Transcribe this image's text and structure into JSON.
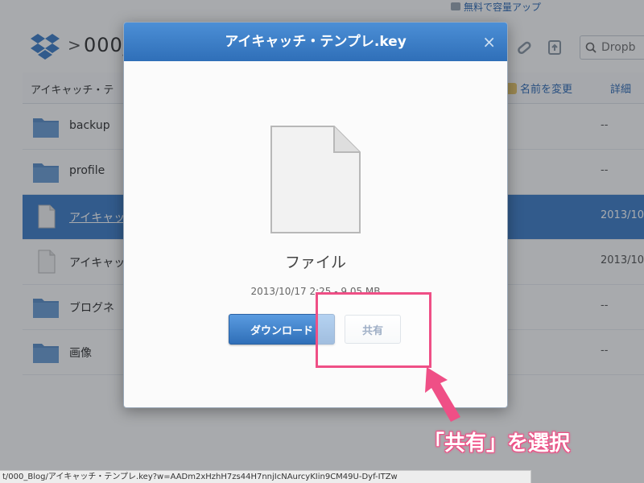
{
  "promo": {
    "text": "無料で容量アップ"
  },
  "header": {
    "breadcrumb_separator": ">",
    "folder_name": "000_",
    "search_placeholder": "Dropb"
  },
  "toolbar": {
    "selected_title": "アイキャッチ・テ",
    "rename_label": "名前を変更",
    "details_label": "詳細"
  },
  "files": [
    {
      "name": "backup",
      "type": "folder",
      "modified": "--",
      "selected": false
    },
    {
      "name": "profile",
      "type": "folder",
      "modified": "--",
      "selected": false
    },
    {
      "name": "アイキャッ",
      "type": "file",
      "modified": "2013/10",
      "selected": true
    },
    {
      "name": "アイキャッ",
      "type": "file",
      "modified": "2013/10",
      "selected": false
    },
    {
      "name": "ブログネ",
      "type": "folder",
      "modified": "--",
      "selected": false
    },
    {
      "name": "画像",
      "type": "folder",
      "modified": "--",
      "selected": false
    }
  ],
  "modal": {
    "title": "アイキャッチ・テンプレ.key",
    "close_symbol": "×",
    "file_kind": "ファイル",
    "file_meta": "2013/10/17 2:25 - 9.05 MB",
    "download_label": "ダウンロード",
    "share_label": "共有"
  },
  "annotation": {
    "caption": "「共有」を選択",
    "color": "#ef4f86"
  },
  "status_bar": {
    "url": "t/000_Blog/アイキャッチ・テンプレ.key?w=AADm2xHzhH7zs44H7nnjIcNAurcyKIin9CM49U-Dyf-ITZw"
  },
  "colors": {
    "accent": "#2f6fb8",
    "selected_row": "#3f7fc8",
    "folder": "#5b8fc9"
  }
}
